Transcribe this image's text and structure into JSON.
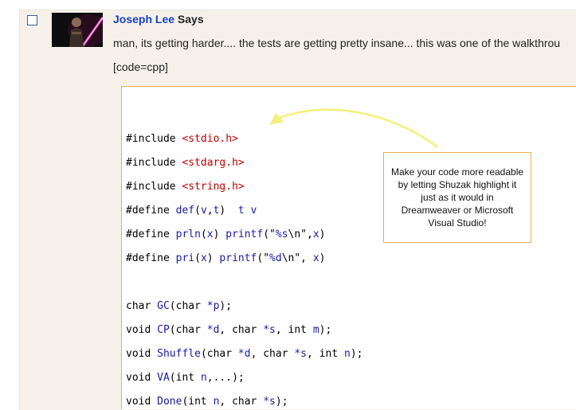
{
  "comment": {
    "author": "Joseph Lee",
    "says": "Says",
    "text": "man, its getting harder.... the tests are getting pretty insane... this was one of the walkthrou",
    "code_tag": "[code=cpp]"
  },
  "code": {
    "lines": [
      [
        {
          "t": "#include "
        },
        {
          "t": "<stdio.h>",
          "c": "str"
        }
      ],
      [
        {
          "t": "#include "
        },
        {
          "t": "<stdarg.h>",
          "c": "str"
        }
      ],
      [
        {
          "t": "#include "
        },
        {
          "t": "<string.h>",
          "c": "str"
        }
      ],
      [
        {
          "t": "#define "
        },
        {
          "t": "def",
          "c": "fn"
        },
        {
          "t": "("
        },
        {
          "t": "v",
          "c": "fn"
        },
        {
          "t": ","
        },
        {
          "t": "t",
          "c": "fn"
        },
        {
          "t": ")  "
        },
        {
          "t": "t",
          "c": "fn"
        },
        {
          "t": " "
        },
        {
          "t": "v",
          "c": "fn"
        }
      ],
      [
        {
          "t": "#define "
        },
        {
          "t": "prln",
          "c": "fn"
        },
        {
          "t": "("
        },
        {
          "t": "x",
          "c": "fn"
        },
        {
          "t": ") "
        },
        {
          "t": "printf",
          "c": "fn"
        },
        {
          "t": "(\""
        },
        {
          "t": "%s",
          "c": "fn"
        },
        {
          "t": "\\n\","
        },
        {
          "t": "x",
          "c": "fn"
        },
        {
          "t": ")"
        }
      ],
      [
        {
          "t": "#define "
        },
        {
          "t": "pri",
          "c": "fn"
        },
        {
          "t": "("
        },
        {
          "t": "x",
          "c": "fn"
        },
        {
          "t": ") "
        },
        {
          "t": "printf",
          "c": "fn"
        },
        {
          "t": "(\""
        },
        {
          "t": "%d",
          "c": "fn"
        },
        {
          "t": "\\n\", "
        },
        {
          "t": "x",
          "c": "fn"
        },
        {
          "t": ")"
        }
      ],
      [],
      [
        {
          "t": "char "
        },
        {
          "t": "GC",
          "c": "fn"
        },
        {
          "t": "(char "
        },
        {
          "t": "*p",
          "c": "fn"
        },
        {
          "t": ");"
        }
      ],
      [
        {
          "t": "void "
        },
        {
          "t": "CP",
          "c": "fn"
        },
        {
          "t": "(char "
        },
        {
          "t": "*d",
          "c": "fn"
        },
        {
          "t": ", char "
        },
        {
          "t": "*s",
          "c": "fn"
        },
        {
          "t": ", int "
        },
        {
          "t": "m",
          "c": "fn"
        },
        {
          "t": ");"
        }
      ],
      [
        {
          "t": "void "
        },
        {
          "t": "Shuffle",
          "c": "fn"
        },
        {
          "t": "(char "
        },
        {
          "t": "*d",
          "c": "fn"
        },
        {
          "t": ", char "
        },
        {
          "t": "*s",
          "c": "fn"
        },
        {
          "t": ", int "
        },
        {
          "t": "n",
          "c": "fn"
        },
        {
          "t": ");"
        }
      ],
      [
        {
          "t": "void "
        },
        {
          "t": "VA",
          "c": "fn"
        },
        {
          "t": "(int "
        },
        {
          "t": "n",
          "c": "fn"
        },
        {
          "t": ",...);"
        }
      ],
      [
        {
          "t": "void "
        },
        {
          "t": "Done",
          "c": "fn"
        },
        {
          "t": "(int "
        },
        {
          "t": "n",
          "c": "fn"
        },
        {
          "t": ", char "
        },
        {
          "t": "*s",
          "c": "fn"
        },
        {
          "t": ");"
        }
      ]
    ]
  },
  "callout": {
    "text": "Make your code more readable by letting Shuzak highlight it just as it would in Dreamweaver or Microsoft Visual Studio!"
  },
  "colors": {
    "author": "#1a3ec2",
    "string": "#c00000",
    "identifier": "#1a1aa6",
    "callout_border": "#e8b058",
    "arrow": "#f4f07a"
  },
  "icons": {
    "checkbox": "checkbox-icon",
    "arrow": "annotation-arrow-icon"
  }
}
